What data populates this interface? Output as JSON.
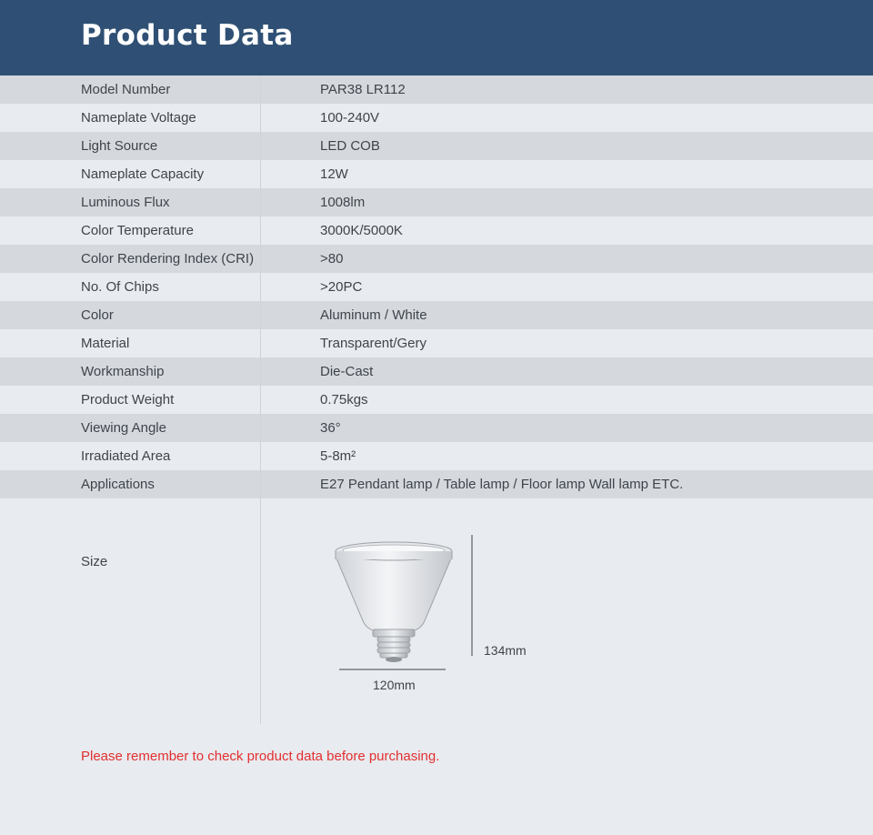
{
  "header": {
    "title": "Product Data"
  },
  "specs": [
    {
      "label": "Model Number",
      "value": "PAR38 LR112"
    },
    {
      "label": "Nameplate Voltage",
      "value": "100-240V"
    },
    {
      "label": "Light Source",
      "value": "LED COB"
    },
    {
      "label": "Nameplate Capacity",
      "value": "12W"
    },
    {
      "label": "Luminous Flux",
      "value": "1008lm"
    },
    {
      "label": "Color Temperature",
      "value": "3000K/5000K"
    },
    {
      "label": "Color Rendering Index (CRI)",
      "value": ">80"
    },
    {
      "label": "No. Of Chips",
      "value": ">20PC"
    },
    {
      "label": "Color",
      "value": "Aluminum / White"
    },
    {
      "label": "Material",
      "value": "Transparent/Gery"
    },
    {
      "label": "Workmanship",
      "value": "Die-Cast"
    },
    {
      "label": "Product Weight",
      "value": "0.75kgs"
    },
    {
      "label": "Viewing Angle",
      "value": "36°"
    },
    {
      "label": "Irradiated Area",
      "value": "5-8m²"
    },
    {
      "label": "Applications",
      "value": "E27 Pendant lamp / Table lamp / Floor lamp Wall lamp ETC."
    }
  ],
  "size": {
    "label": "Size",
    "width": "120mm",
    "height": "134mm"
  },
  "note": "Please remember to check product data before purchasing."
}
